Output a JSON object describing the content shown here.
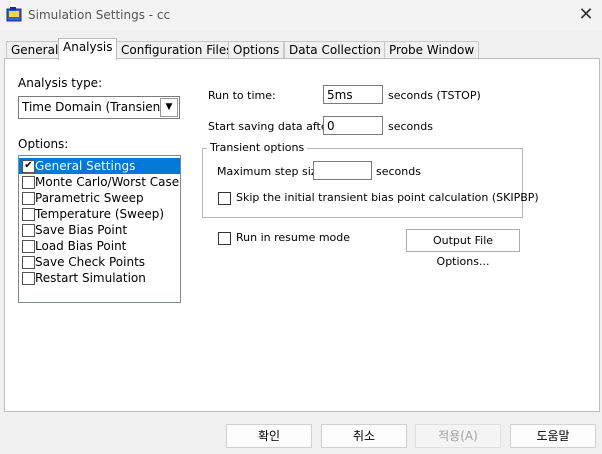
{
  "window": {
    "title": "Simulation Settings - cc"
  },
  "tabs": [
    {
      "label": "General"
    },
    {
      "label": "Analysis"
    },
    {
      "label": "Configuration Files"
    },
    {
      "label": "Options"
    },
    {
      "label": "Data Collection"
    },
    {
      "label": "Probe Window"
    }
  ],
  "analysis": {
    "type_label": "Analysis type:",
    "type_value": "Time Domain (Transient)",
    "options_label": "Options:",
    "options": [
      {
        "label": "General Settings",
        "checked": true,
        "selected": true
      },
      {
        "label": "Monte Carlo/Worst Case",
        "checked": false
      },
      {
        "label": "Parametric Sweep",
        "checked": false
      },
      {
        "label": "Temperature (Sweep)",
        "checked": false
      },
      {
        "label": "Save Bias Point",
        "checked": false
      },
      {
        "label": "Load Bias Point",
        "checked": false
      },
      {
        "label": "Save Check Points",
        "checked": false
      },
      {
        "label": "Restart Simulation",
        "checked": false
      }
    ],
    "run_to_time_label": "Run to time:",
    "run_to_time_value": "5ms",
    "run_to_time_unit": "seconds  (TSTOP)",
    "start_saving_label": "Start saving data after:",
    "start_saving_value": "0",
    "start_saving_unit": "seconds",
    "transient_title": "Transient options",
    "max_step_label": "Maximum step size:",
    "max_step_value": "",
    "max_step_unit": "seconds",
    "skip_bias_label": "Skip the initial transient bias point calculation  (SKIPBP)",
    "resume_label": "Run in resume mode",
    "output_file_button": "Output File Options..."
  },
  "footer": {
    "ok": "확인",
    "cancel": "취소",
    "apply": "적용(A)",
    "help": "도움말"
  }
}
